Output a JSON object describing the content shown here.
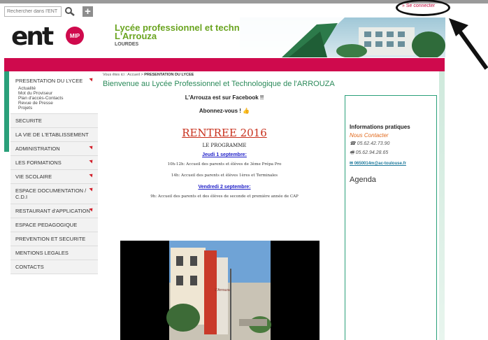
{
  "header": {
    "search_placeholder": "Rechercher dans l'ENT",
    "logo_text": "ent",
    "logo_badge": "MIP",
    "school_line1": "Lycée professionnel et technologique",
    "school_line2": "L'Arrouza",
    "town": "LOURDES",
    "login": "» Se connecter"
  },
  "sidebar": {
    "first": {
      "label": "PRESENTATION DU LYCEE",
      "subitems": [
        "Actualité",
        "Mot du Proviseur",
        "Plan d'accès-Contacts",
        "Revue de Presse",
        "Projets"
      ]
    },
    "items": [
      {
        "label": "SECURITE",
        "caret": false
      },
      {
        "label": "LA VIE DE L'ETABLISSEMENT",
        "caret": false
      },
      {
        "label": "ADMINISTRATION",
        "caret": true
      },
      {
        "label": "LES FORMATIONS",
        "caret": true
      },
      {
        "label": "VIE SCOLAIRE",
        "caret": true
      },
      {
        "label": "ESPACE DOCUMENTATION / C.D.I",
        "caret": true
      },
      {
        "label": "RESTAURANT d'APPLICATION",
        "caret": true
      },
      {
        "label": "ESPACE PEDAGOGIQUE",
        "caret": false
      },
      {
        "label": "PREVENTION ET SECURITE",
        "caret": false
      },
      {
        "label": "MENTIONS LEGALES",
        "caret": false
      },
      {
        "label": "CONTACTS",
        "caret": false
      }
    ]
  },
  "main": {
    "breadcrumb_prefix": "Vous êtes ici :",
    "breadcrumb_home": "Accueil",
    "breadcrumb_sep": ">",
    "breadcrumb_current": "PRESENTATION DU LYCEE",
    "welcome": "Bienvenue au Lycée Professionnel et Technologique de l'ARROUZA",
    "facebook": "L'Arrouza est sur Facebook !!",
    "subscribe": "Abonnez-vous ! 👍",
    "rentree": "RENTREE 2016",
    "programme": "LE PROGRAMME",
    "date1": "Jeudi 1 septembre:",
    "line1": "10h-12h: Accueil des parents et élèves de 3ème Prépa Pro",
    "line2": "14h: Accueil des parents et élèves 1ères et Terminales",
    "date2": "Vendredi 2 septembre:",
    "line3": "9h: Accueil des parents et des élèves de seconde et première année de CAP",
    "photo_sign": "L'Arrouza"
  },
  "panel": {
    "title": "Informations pratiques",
    "contact": "Nous Contacter",
    "phone": "05.62.42.73.90",
    "fax": "05.62.94.28.65",
    "email": "0650014m@ac-toulouse.fr",
    "agenda": "Agenda"
  },
  "colors": {
    "brand_red": "#cf0a4d",
    "brand_green": "#2aa07a",
    "title_green": "#6aa420"
  }
}
